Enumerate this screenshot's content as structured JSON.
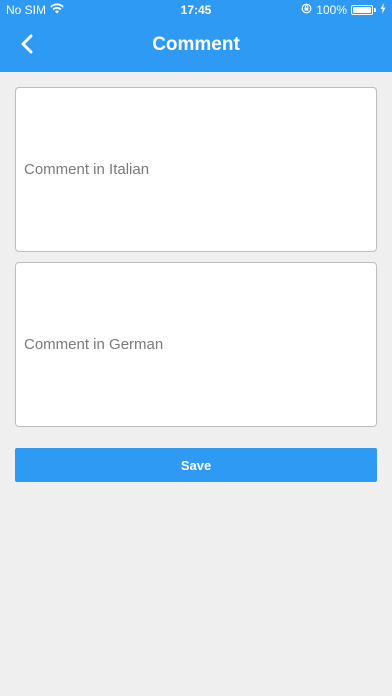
{
  "status_bar": {
    "carrier": "No SIM",
    "time": "17:45",
    "battery_percent": "100%",
    "icons": [
      "wifi-icon",
      "rotation-lock-icon",
      "battery-icon",
      "charging-icon"
    ]
  },
  "nav": {
    "title": "Comment",
    "back_icon": "chevron-left-icon"
  },
  "form": {
    "italian": {
      "placeholder": "Comment in Italian",
      "value": ""
    },
    "german": {
      "placeholder": "Comment in German",
      "value": ""
    },
    "save_label": "Save"
  },
  "colors": {
    "primary": "#2f9af3",
    "background": "#efefef",
    "field_border": "#bdbdbd"
  }
}
